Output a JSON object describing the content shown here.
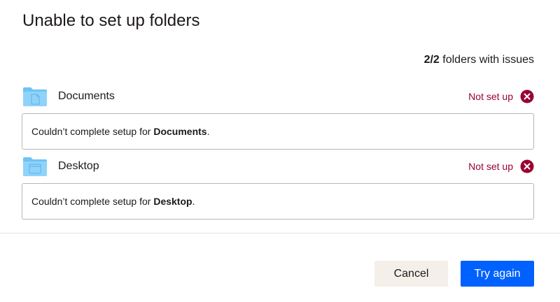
{
  "dialog": {
    "title": "Unable to set up folders",
    "summary_count": "2/2",
    "summary_text": " folders with issues"
  },
  "folders": [
    {
      "name": "Documents",
      "icon": "documents-folder-icon",
      "status": "Not set up",
      "message_prefix": "Couldn’t complete setup for ",
      "message_bold": "Documents",
      "message_suffix": "."
    },
    {
      "name": "Desktop",
      "icon": "desktop-folder-icon",
      "status": "Not set up",
      "message_prefix": "Couldn’t complete setup for ",
      "message_bold": "Desktop",
      "message_suffix": "."
    }
  ],
  "buttons": {
    "cancel": "Cancel",
    "try_again": "Try again"
  },
  "colors": {
    "error": "#9b0032",
    "primary": "#0061fe",
    "secondary_button": "#f4efe9",
    "folder_blue": "#6cc3f5"
  }
}
